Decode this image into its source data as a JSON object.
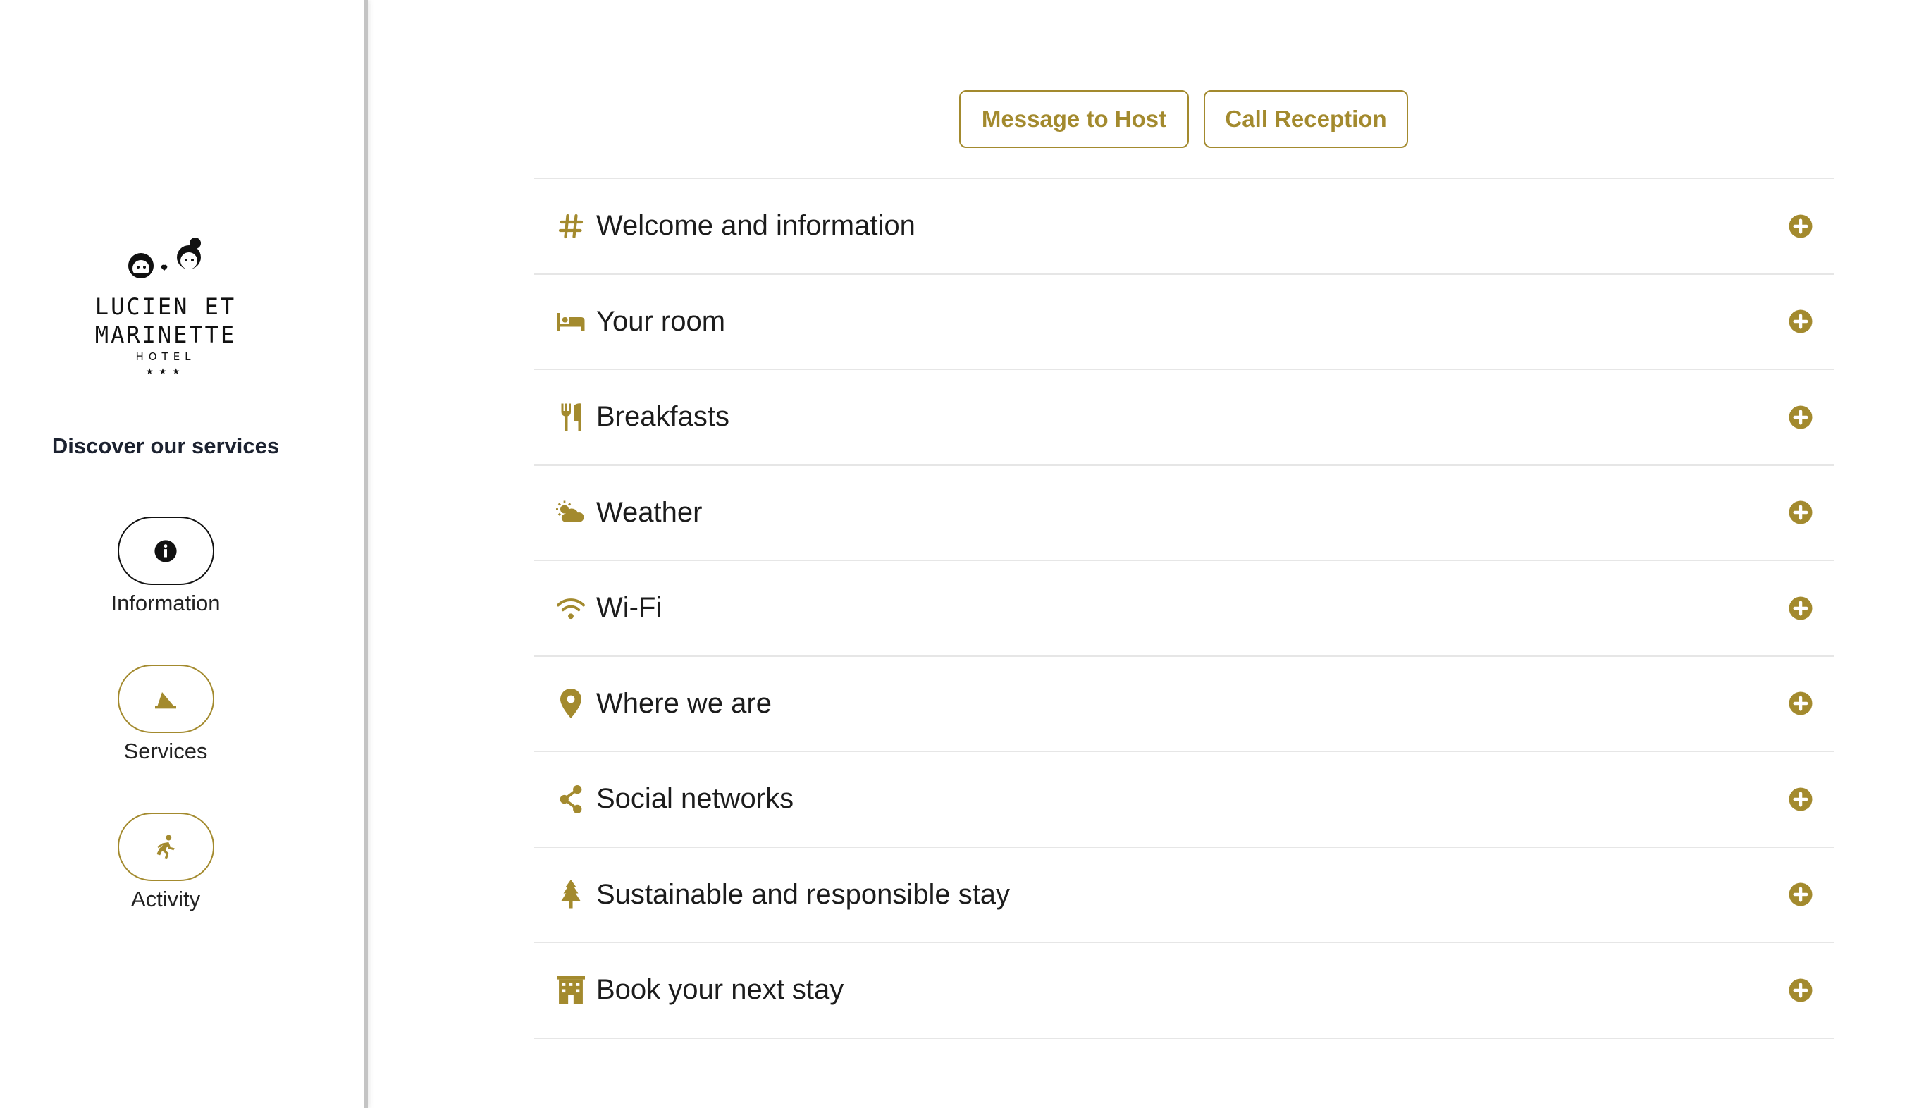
{
  "brand": {
    "name": "LUCIEN ET MARINETTE",
    "subtitle": "HOTEL",
    "stars": "★★★"
  },
  "sidebar": {
    "title": "Discover our services",
    "items": [
      {
        "label": "Information",
        "icon": "info-icon",
        "active": true
      },
      {
        "label": "Services",
        "icon": "bell-service-icon",
        "active": false
      },
      {
        "label": "Activity",
        "icon": "running-person-icon",
        "active": false
      }
    ]
  },
  "actions": {
    "message_label": "Message to Host",
    "call_label": "Call Reception"
  },
  "sections": [
    {
      "title": "Welcome and information",
      "icon": "hashtag-icon"
    },
    {
      "title": "Your room",
      "icon": "bed-icon"
    },
    {
      "title": "Breakfasts",
      "icon": "utensils-icon"
    },
    {
      "title": "Weather",
      "icon": "cloud-sun-icon"
    },
    {
      "title": "Wi-Fi",
      "icon": "wifi-icon"
    },
    {
      "title": "Where we are",
      "icon": "map-pin-icon"
    },
    {
      "title": "Social networks",
      "icon": "share-icon"
    },
    {
      "title": "Sustainable and responsible stay",
      "icon": "tree-icon"
    },
    {
      "title": "Book your next stay",
      "icon": "hotel-building-icon"
    }
  ],
  "colors": {
    "accent": "#a38a2e",
    "text": "#1c1c1c",
    "divider": "#e6e6e6"
  }
}
